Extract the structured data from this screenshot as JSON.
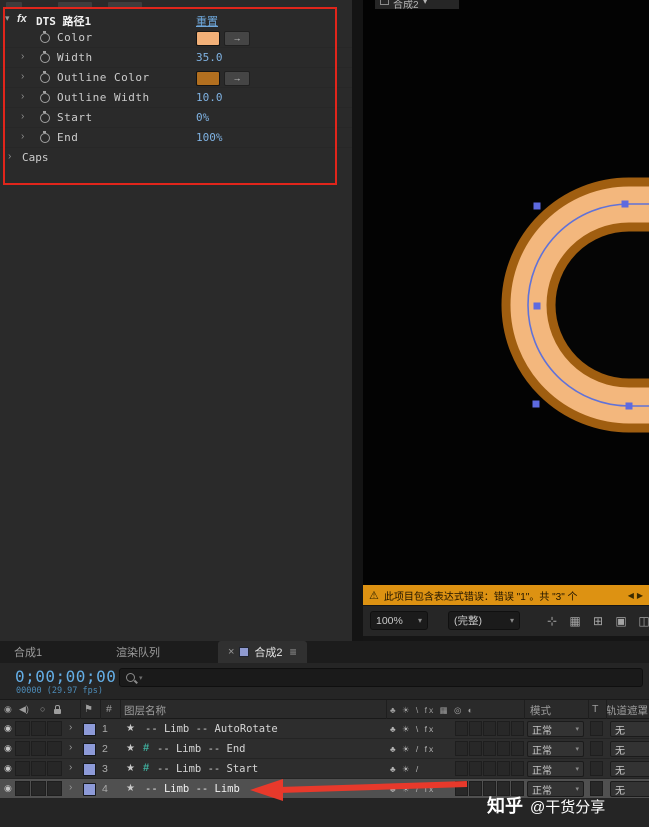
{
  "icons": {
    "expand_caret": "▾",
    "row_chevron": "›",
    "picker_arrow": "→",
    "caret_down": "▾",
    "close": "×",
    "menu": "≡",
    "eye": "◉",
    "audio": "◀)",
    "solo": "○",
    "flag": "⚑",
    "warning": "⚠",
    "star": "★",
    "nav_left": "◀",
    "nav_right": "▶",
    "tools": [
      "⊹",
      "▦",
      "⊞",
      "▣",
      "◫"
    ]
  },
  "effects_panel": {
    "fx_badge": "fx",
    "effect_name": "DTS 路径1",
    "reset_label": "重置",
    "rows": [
      {
        "label": "Color"
      },
      {
        "label": "Width",
        "value": "35.0"
      },
      {
        "label": "Outline Color"
      },
      {
        "label": "Outline Width",
        "value": "10.0"
      },
      {
        "label": "Start",
        "value": "0%"
      },
      {
        "label": "End",
        "value": "100%"
      }
    ],
    "caps_label": "Caps",
    "colors": {
      "fill_swatch": "#f2b078",
      "outline_swatch": "#b26f1f",
      "value_text": "#7fb2e2",
      "annotation": "#e1251b"
    }
  },
  "viewer": {
    "tab_label": "合成2",
    "zoom_value": "100%",
    "resolution_value": "(完整)",
    "warning_text": "此项目包含表达式错误：错误 \"1\"。共 \"3\" 个",
    "shape": {
      "fill": "#f3b77d",
      "outline": "#a05e10",
      "hole": "#050505",
      "path_line": "#6072d8",
      "handle": "#5d6ae0"
    }
  },
  "timeline": {
    "tabs": {
      "comp1": "合成1",
      "render_queue": "渲染队列",
      "comp2": "合成2"
    },
    "timecode": "0;00;00;00",
    "frames_info": "00000 (29.97 fps)",
    "header": {
      "hash": "#",
      "layer_name": "图层名称",
      "switches": "♣ ☀ \\ fx ▦ ◎ ◐",
      "mode": "模式",
      "t": "T",
      "track_matte": "轨道遮罩"
    },
    "layers": [
      {
        "num": "1",
        "name": "-- Limb -- AutoRotate",
        "switches": "♣ ☀ \\ fx",
        "mode": "正常",
        "trkmat": "无"
      },
      {
        "num": "2",
        "hash": "#",
        "name": "-- Limb -- End",
        "switches": "♣ ☀ / fx",
        "mode": "正常",
        "trkmat": "无"
      },
      {
        "num": "3",
        "hash": "#",
        "name": "-- Limb -- Start",
        "switches": "♣ ☀ /",
        "mode": "正常",
        "trkmat": "无"
      },
      {
        "num": "4",
        "name": "-- Limb -- Limb",
        "switches": "♣ ☀ / fx",
        "mode": "正常",
        "trkmat": "无"
      }
    ]
  },
  "watermark": {
    "brand": "知乎",
    "handle": "@干货分享"
  }
}
